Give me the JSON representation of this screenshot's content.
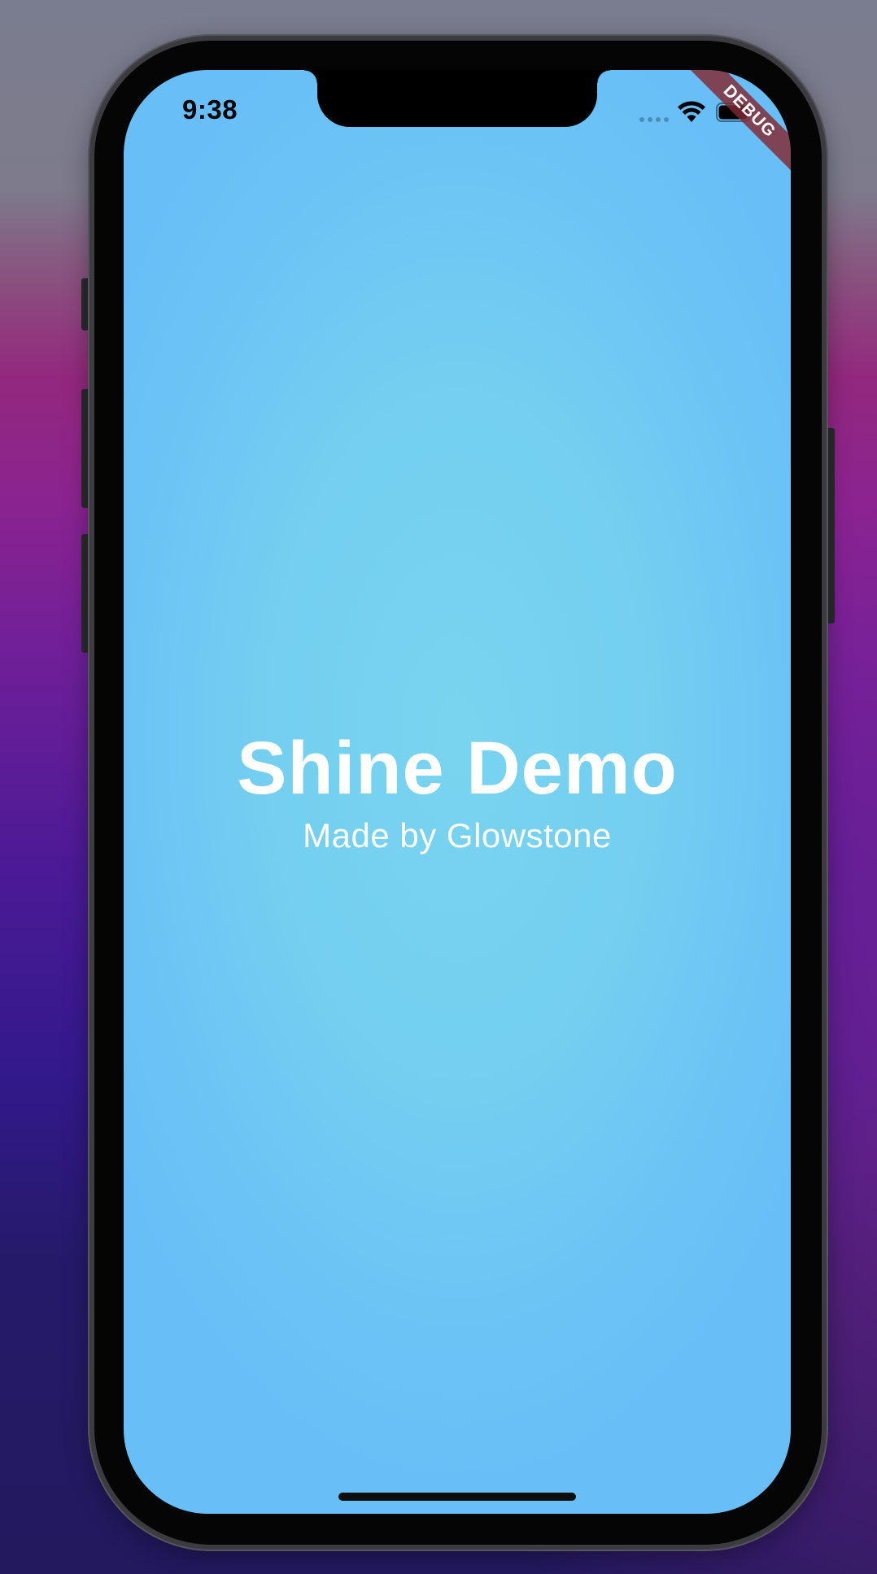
{
  "status_bar": {
    "time": "9:38",
    "signal_icon": "signal-dots-icon",
    "wifi_icon": "wifi-icon",
    "battery_icon": "battery-icon"
  },
  "debug_banner": {
    "label": "DEBUG"
  },
  "main": {
    "title": "Shine Demo",
    "subtitle": "Made by Glowstone"
  },
  "colors": {
    "background_center": "#78d4ef",
    "background_edge": "#68bff7",
    "text": "#ffffff",
    "debug_banner": "#822832"
  }
}
